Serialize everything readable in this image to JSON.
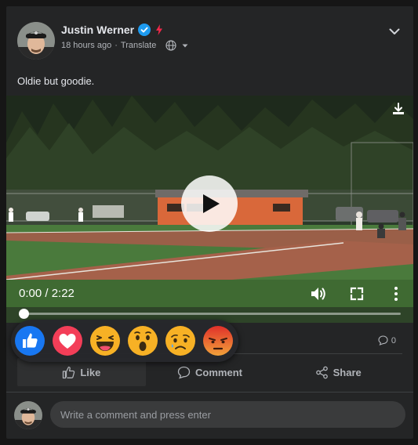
{
  "post": {
    "author": "Justin Werner",
    "timestamp": "18 hours ago",
    "separator": " · ",
    "translate_label": "Translate",
    "text": "Oldie but goodie."
  },
  "video": {
    "time_display": "0:00 / 2:22",
    "progress": 0
  },
  "reactions": [
    "like",
    "love",
    "haha",
    "wow",
    "sad",
    "angry"
  ],
  "stats": {
    "comments_count": "0"
  },
  "actions": {
    "like_label": "Like",
    "comment_label": "Comment",
    "share_label": "Share"
  },
  "comment_box": {
    "placeholder": "Write a comment and press enter"
  },
  "colors": {
    "card_bg": "#242526",
    "page_bg": "#161616",
    "verified_blue": "#1d9bf0",
    "like_blue": "#1877f2",
    "love_red": "#f33e58",
    "emoji_yellow": "#f7b125",
    "angry_red": "#e9710f"
  },
  "icons": [
    "verified-icon",
    "bolt-icon",
    "globe-icon",
    "chevron-down-icon",
    "download-icon",
    "play-icon",
    "volume-icon",
    "fullscreen-icon",
    "more-vertical-icon",
    "comment-bubble-icon",
    "thumbs-up-icon",
    "share-icon"
  ]
}
